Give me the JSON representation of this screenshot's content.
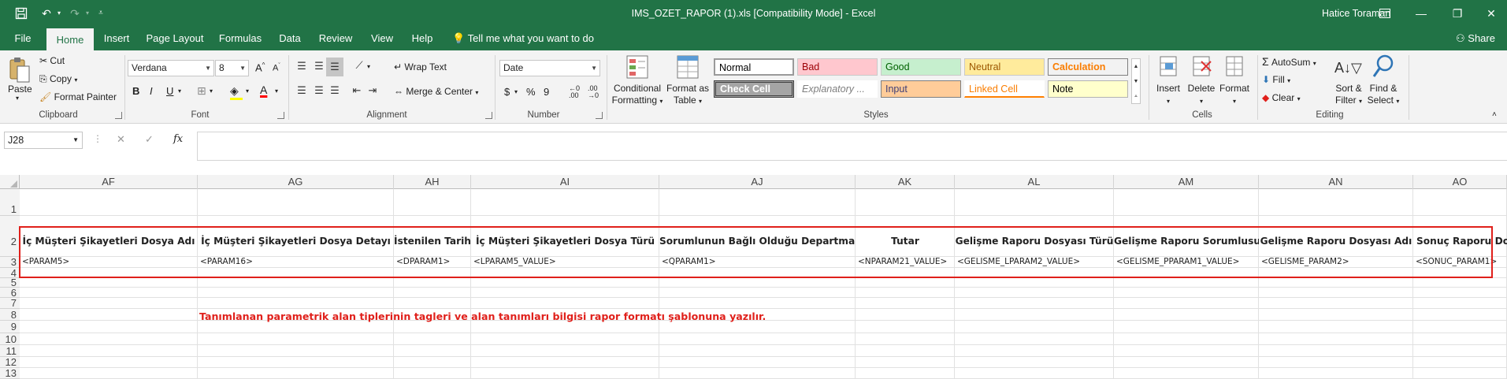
{
  "titlebar": {
    "title": "IMS_OZET_RAPOR (1).xls  [Compatibility Mode]  -  Excel",
    "user": "Hatice Toraman"
  },
  "tabs": [
    "File",
    "Home",
    "Insert",
    "Page Layout",
    "Formulas",
    "Data",
    "Review",
    "View",
    "Help"
  ],
  "active_tab": "Home",
  "tell_me": "Tell me what you want to do",
  "share": "Share",
  "ribbon": {
    "clipboard": {
      "paste": "Paste",
      "cut": "Cut",
      "copy": "Copy",
      "format_painter": "Format Painter",
      "label": "Clipboard"
    },
    "font": {
      "name": "Verdana",
      "size": "8",
      "bold": "B",
      "italic": "I",
      "underline": "U",
      "label": "Font"
    },
    "alignment": {
      "wrap": "Wrap Text",
      "merge": "Merge & Center",
      "label": "Alignment"
    },
    "number": {
      "format": "Date",
      "currency": "$",
      "percent": "%",
      "comma": "9",
      "label": "Number"
    },
    "styles": {
      "conditional": [
        "Conditional",
        "Formatting"
      ],
      "format_as_table": [
        "Format as",
        "Table"
      ],
      "cells": [
        {
          "text": "Normal",
          "bg": "#ffffff",
          "fg": "#000000"
        },
        {
          "text": "Bad",
          "bg": "#ffc7ce",
          "fg": "#9c0006"
        },
        {
          "text": "Good",
          "bg": "#c6efce",
          "fg": "#006100"
        },
        {
          "text": "Neutral",
          "bg": "#ffeb9c",
          "fg": "#9c5700"
        },
        {
          "text": "Calculation",
          "bg": "#f2f2f2",
          "fg": "#fa7d00"
        },
        {
          "text": "Check Cell",
          "bg": "#a5a5a5",
          "fg": "#ffffff"
        },
        {
          "text": "Explanatory ...",
          "bg": "#ffffff",
          "fg": "#7f7f7f"
        },
        {
          "text": "Input",
          "bg": "#ffcc99",
          "fg": "#3f3f76"
        },
        {
          "text": "Linked Cell",
          "bg": "#ffffff",
          "fg": "#fa7d00"
        },
        {
          "text": "Note",
          "bg": "#ffffcc",
          "fg": "#000000"
        }
      ],
      "label": "Styles"
    },
    "cells": {
      "insert": "Insert",
      "delete": "Delete",
      "format": "Format",
      "label": "Cells"
    },
    "editing": {
      "autosum": "AutoSum",
      "fill": "Fill",
      "clear": "Clear",
      "sort": [
        "Sort &",
        "Filter"
      ],
      "find": [
        "Find &",
        "Select"
      ],
      "label": "Editing"
    }
  },
  "formula_bar": {
    "name_box": "J28",
    "fx": "fx",
    "value": ""
  },
  "grid": {
    "columns": [
      "AF",
      "AG",
      "AH",
      "AI",
      "AJ",
      "AK",
      "AL",
      "AM",
      "AN",
      "AO"
    ],
    "rows": [
      "1",
      "2",
      "3",
      "4",
      "5",
      "6",
      "7",
      "8",
      "9",
      "10",
      "11",
      "12",
      "13"
    ],
    "header_row": [
      "İç Müşteri Şikayetleri  Dosya Adı",
      "İç Müşteri Şikayetleri  Dosya Detayı",
      "İstenilen Tarih",
      "İç Müşteri Şikayetleri  Dosya Türü",
      "Sorumlunun Bağlı Olduğu Departman",
      "Tutar",
      "Gelişme Raporu Dosyası Türü",
      "Gelişme Raporu Sorumlusu",
      "Gelişme Raporu Dosyası Adı",
      "Sonuç Raporu Dosyası Adı"
    ],
    "value_row": [
      "<PARAM5>",
      "<PARAM16>",
      "<DPARAM1>",
      "<LPARAM5_VALUE>",
      "<QPARAM1>",
      "<NPARAM21_VALUE>",
      "<GELISME_LPARAM2_VALUE>",
      "<GELISME_PPARAM1_VALUE>",
      "<GELISME_PARAM2>",
      "<SONUC_PARAM1>"
    ],
    "note": "Tanımlanan parametrik alan tiplerinin tagleri ve alan tanımları bilgisi rapor formatı şablonuna yazılır."
  }
}
